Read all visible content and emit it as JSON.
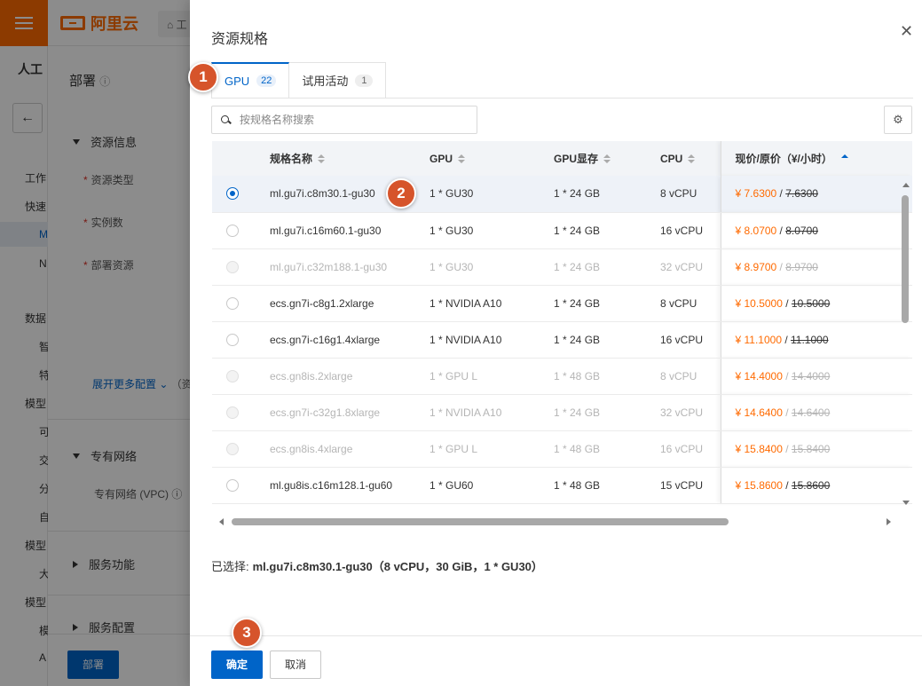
{
  "background": {
    "logo_text": "阿里云",
    "breadcrumb_text": "⌂ 工",
    "nav_title": "人工",
    "nav_items": [
      "工作",
      "快速",
      "M",
      "N",
      "数据",
      "智",
      "特",
      "模型",
      "可",
      "交",
      "分",
      "自",
      "模型",
      "大",
      "模型",
      "模",
      "A"
    ],
    "main_title": "部署",
    "sections": {
      "resource_info": "资源信息",
      "private_network": "专有网络",
      "service_function": "服务功能",
      "service_config": "服务配置"
    },
    "fields": {
      "resource_type": "资源类型",
      "instance_count": "实例数",
      "deploy_resource": "部署资源",
      "vpc": "专有网络 (VPC)"
    },
    "expand_link": "展开更多配置",
    "expand_link_suffix": "（资",
    "deploy_button": "部署"
  },
  "drawer": {
    "title": "资源规格",
    "close_icon": "close-icon",
    "tabs": [
      {
        "label": "GPU",
        "count": "22",
        "active": true
      },
      {
        "label": "试用活动",
        "count": "1",
        "active": false
      }
    ],
    "search": {
      "placeholder": "按规格名称搜索",
      "value": ""
    },
    "table": {
      "columns": {
        "name": "规格名称",
        "gpu": "GPU",
        "gpu_memory": "GPU显存",
        "cpu": "CPU",
        "price": "现价/原价（¥/小时）"
      },
      "rows": [
        {
          "name": "ml.gu7i.c8m30.1-gu30",
          "gpu": "1 * GU30",
          "mem": "1 * 24 GB",
          "cpu": "8 vCPU",
          "price": "¥ 7.6300",
          "sep": " / ",
          "orig": "7.6300",
          "selected": true,
          "disabled": false
        },
        {
          "name": "ml.gu7i.c16m60.1-gu30",
          "gpu": "1 * GU30",
          "mem": "1 * 24 GB",
          "cpu": "16 vCPU",
          "price": "¥ 8.0700",
          "sep": " / ",
          "orig": "8.0700",
          "selected": false,
          "disabled": false
        },
        {
          "name": "ml.gu7i.c32m188.1-gu30",
          "gpu": "1 * GU30",
          "mem": "1 * 24 GB",
          "cpu": "32 vCPU",
          "price": "¥ 8.9700",
          "sep": " / ",
          "orig": "8.9700",
          "selected": false,
          "disabled": true
        },
        {
          "name": "ecs.gn7i-c8g1.2xlarge",
          "gpu": "1 * NVIDIA A10",
          "mem": "1 * 24 GB",
          "cpu": "8 vCPU",
          "price": "¥ 10.5000",
          "sep": " / ",
          "orig": "10.5000",
          "selected": false,
          "disabled": false
        },
        {
          "name": "ecs.gn7i-c16g1.4xlarge",
          "gpu": "1 * NVIDIA A10",
          "mem": "1 * 24 GB",
          "cpu": "16 vCPU",
          "price": "¥ 11.1000",
          "sep": " / ",
          "orig": "11.1000",
          "selected": false,
          "disabled": false
        },
        {
          "name": "ecs.gn8is.2xlarge",
          "gpu": "1 * GPU L",
          "mem": "1 * 48 GB",
          "cpu": "8 vCPU",
          "price": "¥ 14.4000",
          "sep": " / ",
          "orig": "14.4000",
          "selected": false,
          "disabled": true
        },
        {
          "name": "ecs.gn7i-c32g1.8xlarge",
          "gpu": "1 * NVIDIA A10",
          "mem": "1 * 24 GB",
          "cpu": "32 vCPU",
          "price": "¥ 14.6400",
          "sep": " / ",
          "orig": "14.6400",
          "selected": false,
          "disabled": true
        },
        {
          "name": "ecs.gn8is.4xlarge",
          "gpu": "1 * GPU L",
          "mem": "1 * 48 GB",
          "cpu": "16 vCPU",
          "price": "¥ 15.8400",
          "sep": " / ",
          "orig": "15.8400",
          "selected": false,
          "disabled": true
        },
        {
          "name": "ml.gu8is.c16m128.1-gu60",
          "gpu": "1 * GU60",
          "mem": "1 * 48 GB",
          "cpu": "15 vCPU",
          "price": "¥ 15.8600",
          "sep": " / ",
          "orig": "15.8600",
          "selected": false,
          "disabled": false
        }
      ]
    },
    "selected_label": "已选择:",
    "selected_value": "ml.gu7i.c8m30.1-gu30（8 vCPU，30 GiB，1 * GU30）",
    "ok_button": "确定",
    "cancel_button": "取消"
  },
  "step_markers": [
    "1",
    "2",
    "3"
  ],
  "colors": {
    "accent": "#0064c8",
    "brand": "#ff6a00",
    "step_marker": "#d6542b"
  }
}
